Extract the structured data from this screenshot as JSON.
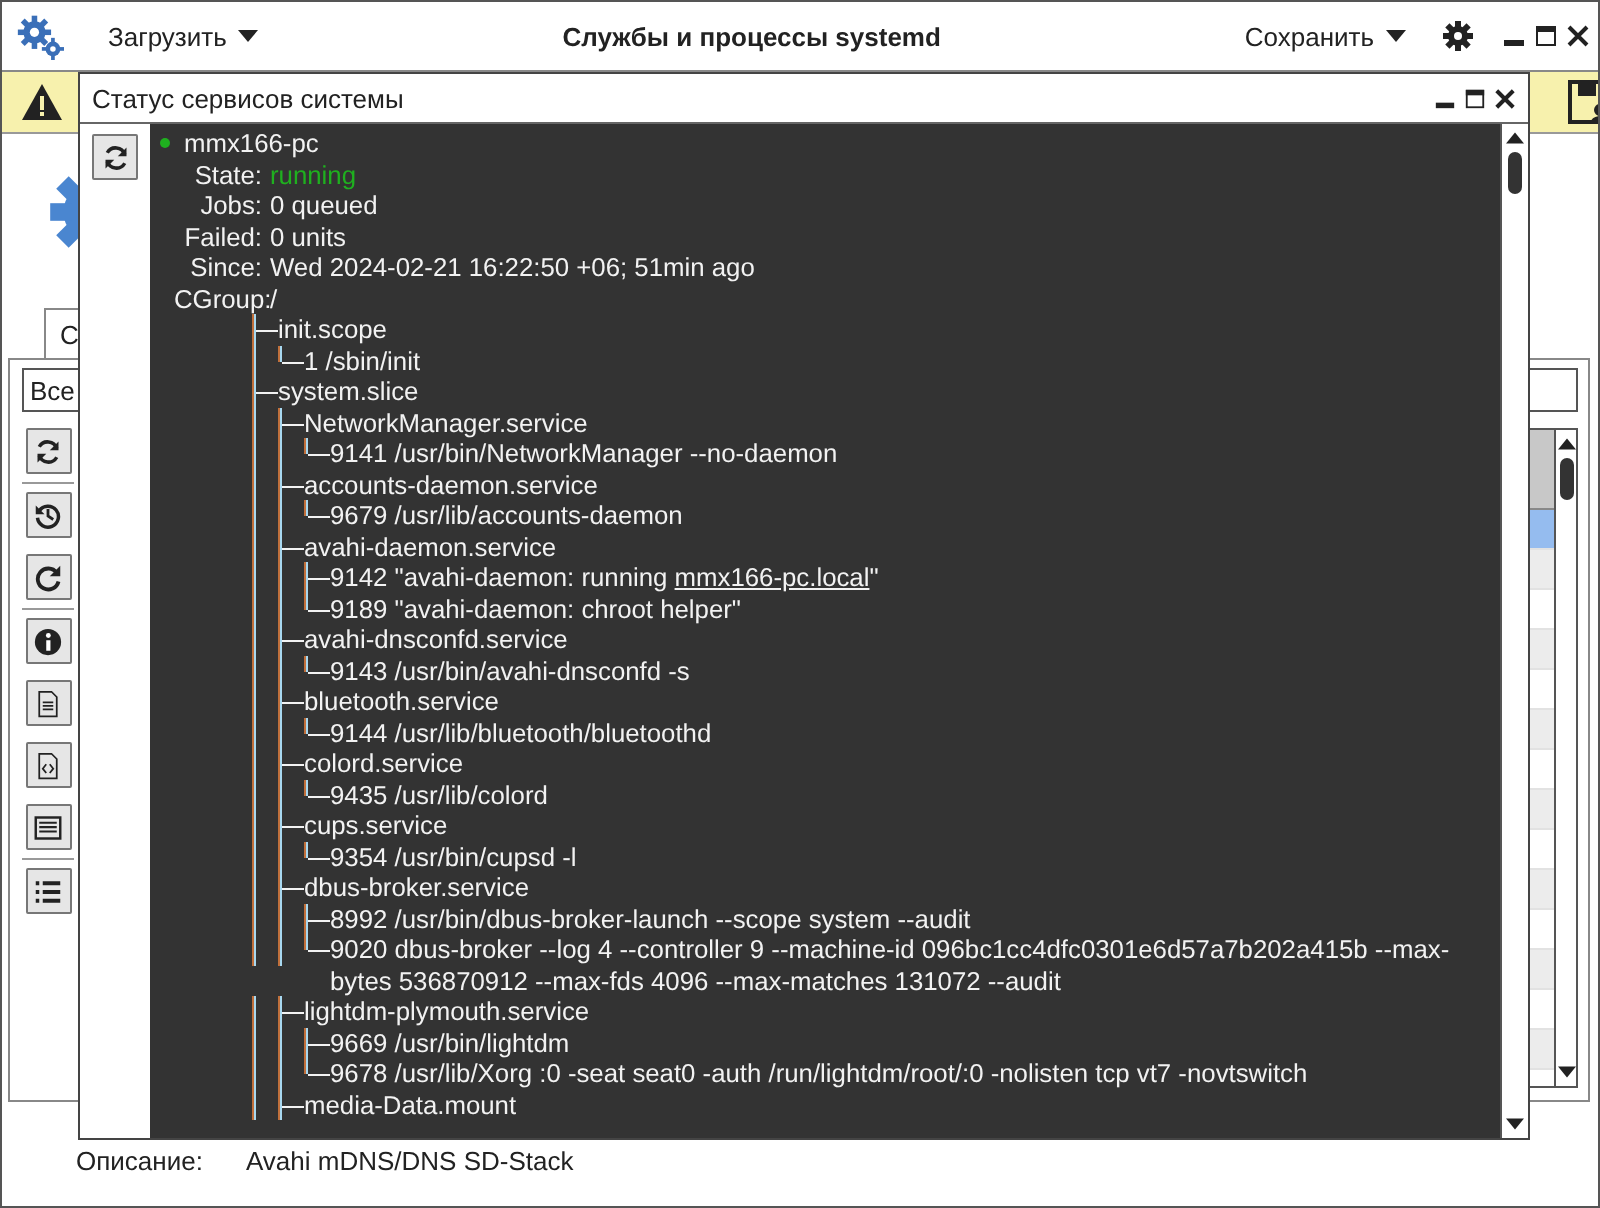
{
  "app": {
    "load_menu": "Загрузить",
    "title": "Службы и процессы systemd",
    "save_menu": "Сохранить"
  },
  "tabs": [
    {
      "label": "С",
      "selected": true
    }
  ],
  "filter": {
    "value": "Все"
  },
  "table": {
    "rows": [
      {
        "selected": true
      },
      {
        "selected": false
      },
      {
        "selected": false
      },
      {
        "selected": false
      },
      {
        "selected": false
      },
      {
        "selected": false
      },
      {
        "selected": false
      },
      {
        "selected": false
      },
      {
        "selected": false
      },
      {
        "selected": false
      },
      {
        "selected": false
      },
      {
        "selected": false
      },
      {
        "selected": false
      },
      {
        "selected": false
      }
    ]
  },
  "description": {
    "label": "Описание:",
    "value": "Avahi mDNS/DNS SD-Stack"
  },
  "dialog": {
    "title": "Статус сервисов системы",
    "host": "mmx166-pc",
    "active": true,
    "fields": [
      {
        "label": "State:",
        "value": "running",
        "kind": "status"
      },
      {
        "label": "Jobs:",
        "value": "0 queued",
        "kind": "plain"
      },
      {
        "label": "Failed:",
        "value": "0 units",
        "kind": "plain"
      },
      {
        "label": "Since:",
        "value": "Wed 2024-02-21 16:22:50 +06; 51min ago",
        "kind": "plain"
      }
    ],
    "cgroup": {
      "label": "CGroup:",
      "value": "/",
      "children": [
        {
          "text": "init.scope",
          "children": [
            {
              "text": "1 /sbin/init"
            }
          ]
        },
        {
          "text": "system.slice",
          "children": [
            {
              "text": "NetworkManager.service",
              "children": [
                {
                  "text": "9141 /usr/bin/NetworkManager --no-daemon"
                }
              ]
            },
            {
              "text": "accounts-daemon.service",
              "children": [
                {
                  "text": "9679 /usr/lib/accounts-daemon"
                }
              ]
            },
            {
              "text": "avahi-daemon.service",
              "children": [
                {
                  "text": "9142 \"avahi-daemon: running ",
                  "link": "mmx166-pc.local",
                  "suffix": "\""
                },
                {
                  "text": "9189 \"avahi-daemon: chroot helper\""
                }
              ]
            },
            {
              "text": "avahi-dnsconfd.service",
              "children": [
                {
                  "text": "9143 /usr/bin/avahi-dnsconfd -s"
                }
              ]
            },
            {
              "text": "bluetooth.service",
              "children": [
                {
                  "text": "9144 /usr/lib/bluetooth/bluetoothd"
                }
              ]
            },
            {
              "text": "colord.service",
              "children": [
                {
                  "text": "9435 /usr/lib/colord"
                }
              ]
            },
            {
              "text": "cups.service",
              "children": [
                {
                  "text": "9354 /usr/bin/cupsd -l"
                }
              ]
            },
            {
              "text": "dbus-broker.service",
              "children": [
                {
                  "text": "8992 /usr/bin/dbus-broker-launch --scope system --audit"
                },
                {
                  "text": "9020 dbus-broker --log 4 --controller 9 --machine-id 096bc1cc4dfc0301e6d57a7b202a415b --max-bytes 536870912 --max-fds 4096 --max-matches 131072 --audit"
                }
              ]
            },
            {
              "text": "lightdm-plymouth.service",
              "children": [
                {
                  "text": "9669 /usr/bin/lightdm"
                },
                {
                  "text": "9678 /usr/lib/Xorg :0 -seat seat0 -auth /run/lightdm/root/:0 -nolisten tcp vt7 -novtswitch"
                }
              ]
            },
            {
              "text": "media-Data.mount"
            }
          ]
        }
      ]
    }
  }
}
